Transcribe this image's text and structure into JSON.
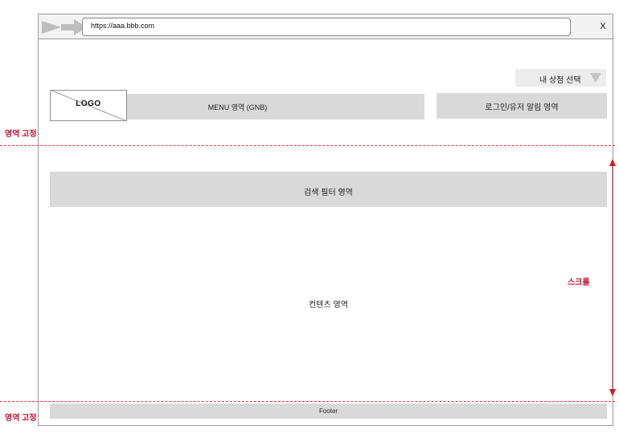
{
  "browser": {
    "url": "https://aaa.bbb.com",
    "close_label": "X",
    "nav_icon": "back-forward-arrows-icon"
  },
  "store_selector": {
    "label": "내 상점 선택",
    "icon": "triangle-down-icon"
  },
  "header": {
    "logo": "LOGO",
    "gnb": "MENU 영역 (GNB)",
    "login_area": "로그인/유저 알림 영역"
  },
  "annotations": {
    "fixed_area_top": "영역 고정",
    "fixed_area_bottom": "영역 고정",
    "scroll": "스크롤",
    "accent_color": "#c8102e"
  },
  "search_filter": {
    "label": "검색 필터 영역"
  },
  "content": {
    "label": "컨텐츠 영역"
  },
  "footer": {
    "label": "Footer"
  },
  "colors": {
    "placeholder_fill": "#d9d9d9",
    "frame_border": "#9a9a9a",
    "annotation_red": "#e23a3a"
  }
}
